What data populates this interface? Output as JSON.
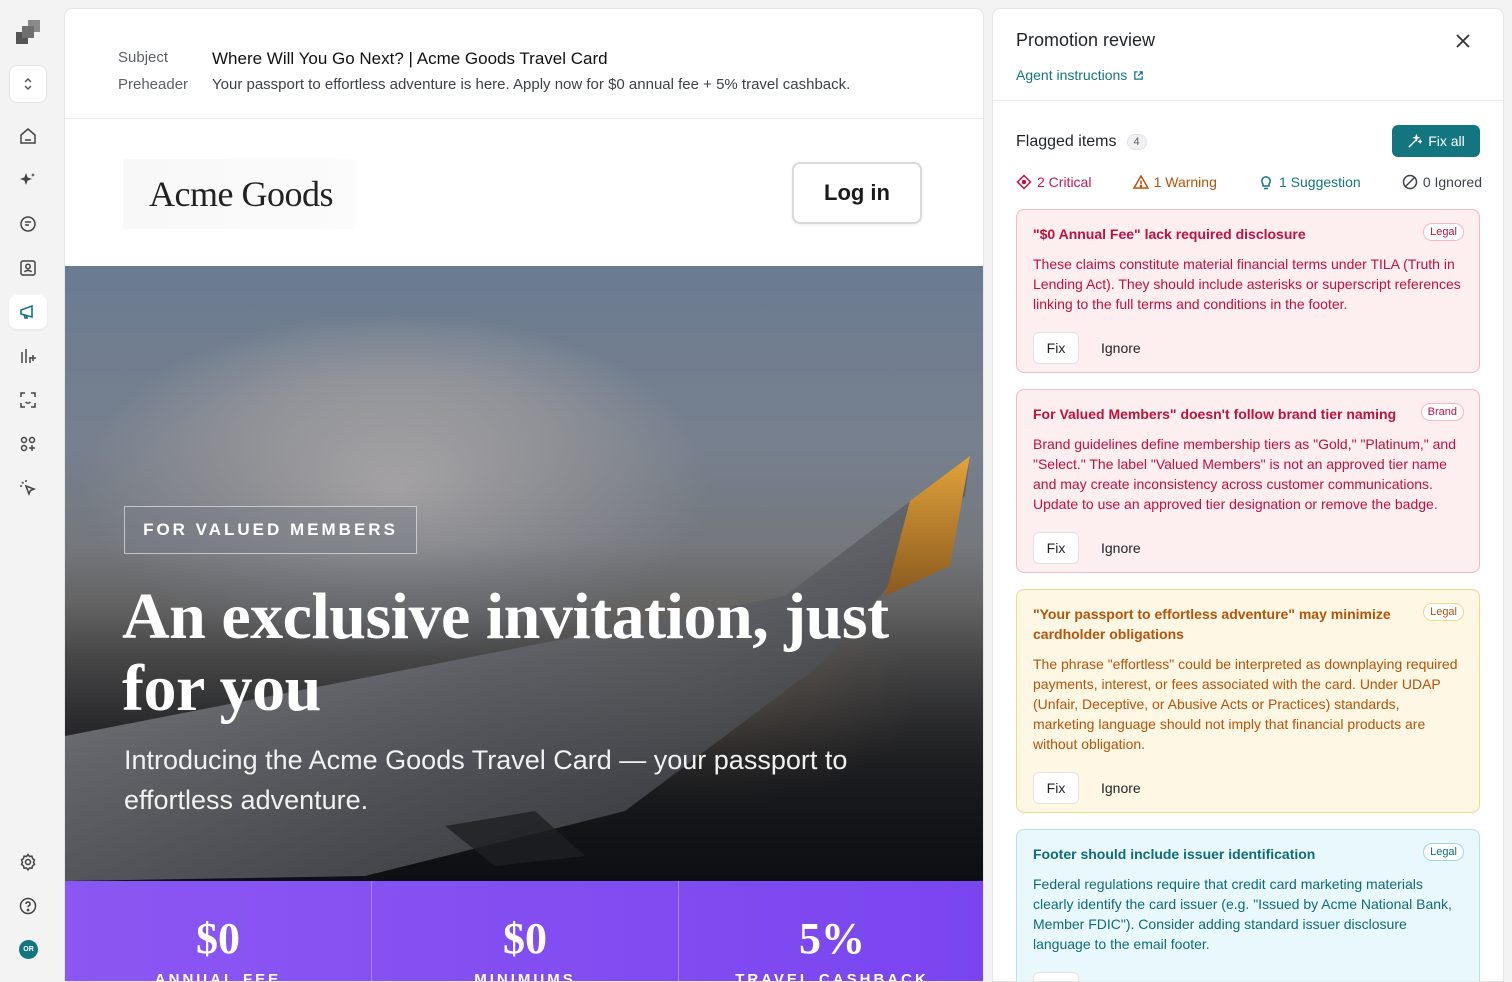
{
  "email": {
    "subject_label": "Subject",
    "subject": "Where Will You Go Next? | Acme Goods Travel Card",
    "preheader_label": "Preheader",
    "preheader": "Your passport to effortless adventure is here. Apply now for $0 annual fee + 5% travel cashback.",
    "brand": "Acme Goods",
    "login_label": "Log in",
    "badge": "FOR VALUED MEMBERS",
    "hero_title": "An exclusive invitation, just for you",
    "hero_subtitle": "Introducing the Acme Goods Travel Card — your passport to effortless adventure.",
    "stats": [
      {
        "value": "$0",
        "label": "ANNUAL FEE"
      },
      {
        "value": "$0",
        "label": "MINIMUMS"
      },
      {
        "value": "5%",
        "label": "TRAVEL CASHBACK"
      }
    ]
  },
  "panel": {
    "title": "Promotion review",
    "agent_link": "Agent instructions",
    "flagged_title": "Flagged items",
    "flagged_count": "4",
    "fix_all_label": "Fix all",
    "filters": {
      "critical": "2 Critical",
      "warning": "1 Warning",
      "suggestion": "1 Suggestion",
      "ignored": "0 Ignored"
    },
    "fix_label": "Fix",
    "ignore_label": "Ignore",
    "cards": [
      {
        "title": "\"$0 Annual Fee\" lack required disclosure",
        "tag": "Legal",
        "body": "These claims constitute material financial terms under TILA (Truth in Lending Act). They should include asterisks or superscript references linking to the full terms and conditions in the footer."
      },
      {
        "title": "For Valued Members\" doesn't follow brand tier naming",
        "tag": "Brand",
        "body": "Brand guidelines define membership tiers as \"Gold,\" \"Platinum,\" and \"Select.\" The label \"Valued Members\" is not an approved tier name and may create inconsistency across customer communications. Update to use an approved tier designation or remove the badge."
      },
      {
        "title": "\"Your passport to effortless adventure\" may minimize cardholder obligations",
        "tag": "Legal",
        "body": "The phrase \"effortless\" could be interpreted as downplaying required payments, interest, or fees associated with the card. Under UDAP (Unfair, Deceptive, or Abusive Acts or Practices) standards, marketing language should not imply that financial products are without obligation."
      },
      {
        "title": "Footer should include issuer identification",
        "tag": "Legal",
        "body": "Federal regulations require that credit card marketing materials clearly identify the card issuer (e.g. \"Issued by Acme National Bank, Member FDIC\"). Consider adding standard issuer disclosure language to the email footer."
      }
    ]
  },
  "user": {
    "initials": "OR"
  },
  "colors": {
    "accent": "#127580",
    "critical": "#be123c",
    "warning": "#b45309",
    "stats_bg": "#8b57f2"
  }
}
